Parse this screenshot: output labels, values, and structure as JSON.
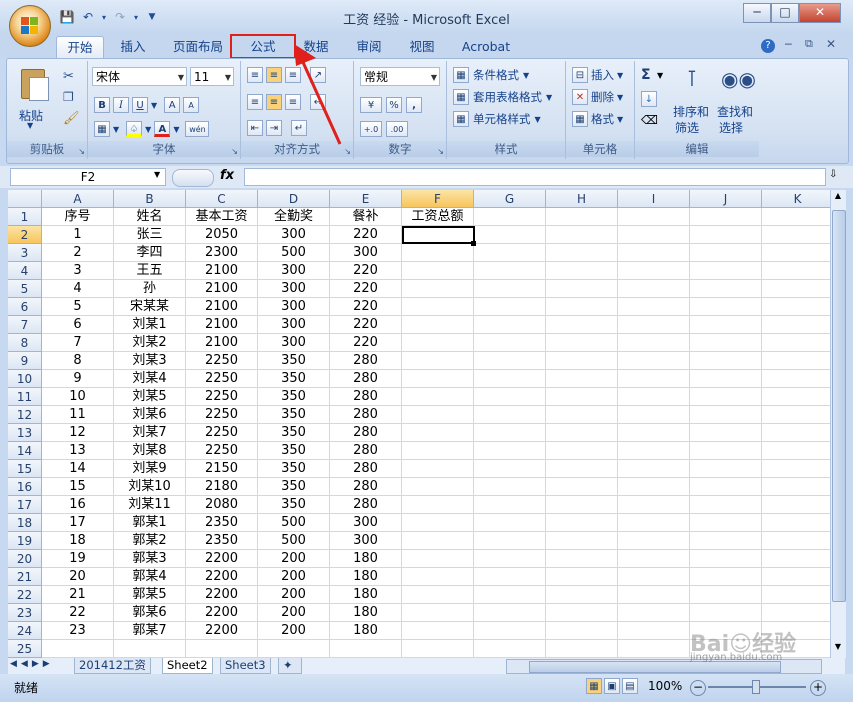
{
  "window": {
    "title": "工资 经验 - Microsoft Excel"
  },
  "tabs": [
    "开始",
    "插入",
    "页面布局",
    "公式",
    "数据",
    "审阅",
    "视图",
    "Acrobat"
  ],
  "clipboard": {
    "paste": "粘贴",
    "label": "剪贴板"
  },
  "font": {
    "name": "宋体",
    "size": "11",
    "label": "字体",
    "bold": "B",
    "italic": "I",
    "underline": "U",
    "grow": "A",
    "shrink": "A",
    "color_letter": "A",
    "phonetic": "wén"
  },
  "alignment": {
    "label": "对齐方式"
  },
  "number": {
    "format": "常规",
    "label": "数字",
    "percent": "%",
    "comma": ",",
    "inc": "+.0",
    "dec": ".00"
  },
  "styles": {
    "conditional": "条件格式",
    "table": "套用表格格式",
    "cell": "单元格样式",
    "label": "样式"
  },
  "cells": {
    "insert": "插入",
    "delete": "删除",
    "format": "格式",
    "label": "单元格"
  },
  "editing": {
    "sort": "排序和",
    "sort2": "筛选",
    "find": "查找和",
    "find2": "选择",
    "label": "编辑",
    "sum": "Σ"
  },
  "formula_bar": {
    "name_box": "F2",
    "fx": "fx",
    "value": ""
  },
  "columns": [
    "A",
    "B",
    "C",
    "D",
    "E",
    "F",
    "G",
    "H",
    "I",
    "J",
    "K"
  ],
  "header_row": [
    "序号",
    "姓名",
    "基本工资",
    "全勤奖",
    "餐补",
    "工资总额"
  ],
  "rows": [
    [
      "1",
      "张三",
      "2050",
      "300",
      "220"
    ],
    [
      "2",
      "李四",
      "2300",
      "500",
      "300"
    ],
    [
      "3",
      "王五",
      "2100",
      "300",
      "220"
    ],
    [
      "4",
      "孙",
      "2100",
      "300",
      "220"
    ],
    [
      "5",
      "宋某某",
      "2100",
      "300",
      "220"
    ],
    [
      "6",
      "刘某1",
      "2100",
      "300",
      "220"
    ],
    [
      "7",
      "刘某2",
      "2100",
      "300",
      "220"
    ],
    [
      "8",
      "刘某3",
      "2250",
      "350",
      "280"
    ],
    [
      "9",
      "刘某4",
      "2250",
      "350",
      "280"
    ],
    [
      "10",
      "刘某5",
      "2250",
      "350",
      "280"
    ],
    [
      "11",
      "刘某6",
      "2250",
      "350",
      "280"
    ],
    [
      "12",
      "刘某7",
      "2250",
      "350",
      "280"
    ],
    [
      "13",
      "刘某8",
      "2250",
      "350",
      "280"
    ],
    [
      "14",
      "刘某9",
      "2150",
      "350",
      "280"
    ],
    [
      "15",
      "刘某10",
      "2180",
      "350",
      "280"
    ],
    [
      "16",
      "刘某11",
      "2080",
      "350",
      "280"
    ],
    [
      "17",
      "郭某1",
      "2350",
      "500",
      "300"
    ],
    [
      "18",
      "郭某2",
      "2350",
      "500",
      "300"
    ],
    [
      "19",
      "郭某3",
      "2200",
      "200",
      "180"
    ],
    [
      "20",
      "郭某4",
      "2200",
      "200",
      "180"
    ],
    [
      "21",
      "郭某5",
      "2200",
      "200",
      "180"
    ],
    [
      "22",
      "郭某6",
      "2200",
      "200",
      "180"
    ],
    [
      "23",
      "郭某7",
      "2200",
      "200",
      "180"
    ]
  ],
  "row_numbers": [
    "1",
    "2",
    "3",
    "4",
    "5",
    "6",
    "7",
    "8",
    "9",
    "10",
    "11",
    "12",
    "13",
    "14",
    "15",
    "16",
    "17",
    "18",
    "19",
    "20",
    "21",
    "22",
    "23",
    "24",
    "25"
  ],
  "sheet_tabs": [
    "201412工资",
    "Sheet2",
    "Sheet3"
  ],
  "status": {
    "ready": "就绪",
    "zoom": "100%"
  },
  "watermark": "jingyan.baidu.com",
  "colors": {
    "highlight": "#e0201b",
    "selected_header": "#f7c65c"
  }
}
